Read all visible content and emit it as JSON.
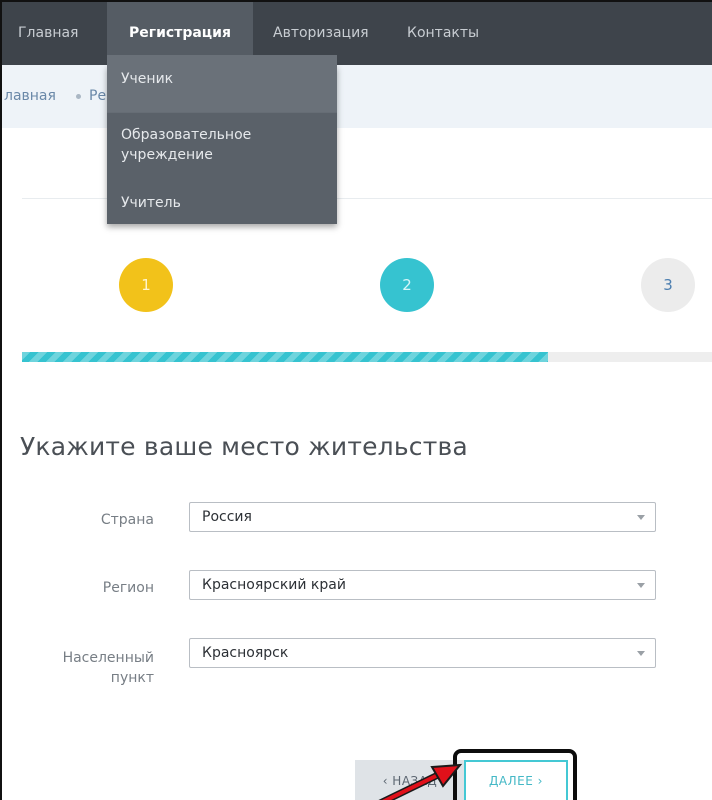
{
  "nav": {
    "items": [
      {
        "label": "Главная"
      },
      {
        "label": "Регистрация"
      },
      {
        "label": "Авторизация"
      },
      {
        "label": "Контакты"
      }
    ]
  },
  "breadcrumb": {
    "items": [
      {
        "label": "лавная"
      },
      {
        "label": "Ре"
      }
    ]
  },
  "dropdown": {
    "items": [
      {
        "label": "Ученик"
      },
      {
        "label_line1": "Образовательное",
        "label_line2": "учреждение"
      },
      {
        "label": "Учитель"
      }
    ]
  },
  "steps": [
    "1",
    "2",
    "3"
  ],
  "progress": {
    "fraction": 0.76
  },
  "heading": "Укажите ваше место жительства",
  "form": {
    "country": {
      "label": "Страна",
      "value": "Россия"
    },
    "region": {
      "label": "Регион",
      "value": "Красноярский край"
    },
    "city": {
      "label_line1": "Населенный",
      "label_line2": "пункт",
      "value": "Красноярск"
    }
  },
  "buttons": {
    "back": "‹ НАЗАД",
    "next": "ДАЛЕЕ ›"
  },
  "colors": {
    "navbar": "#3e444b",
    "step1": "#f2c21a",
    "step2": "#36c3d0",
    "step3": "#ececec",
    "accent": "#36c3d0",
    "annotation_arrow": "#e0101a"
  }
}
